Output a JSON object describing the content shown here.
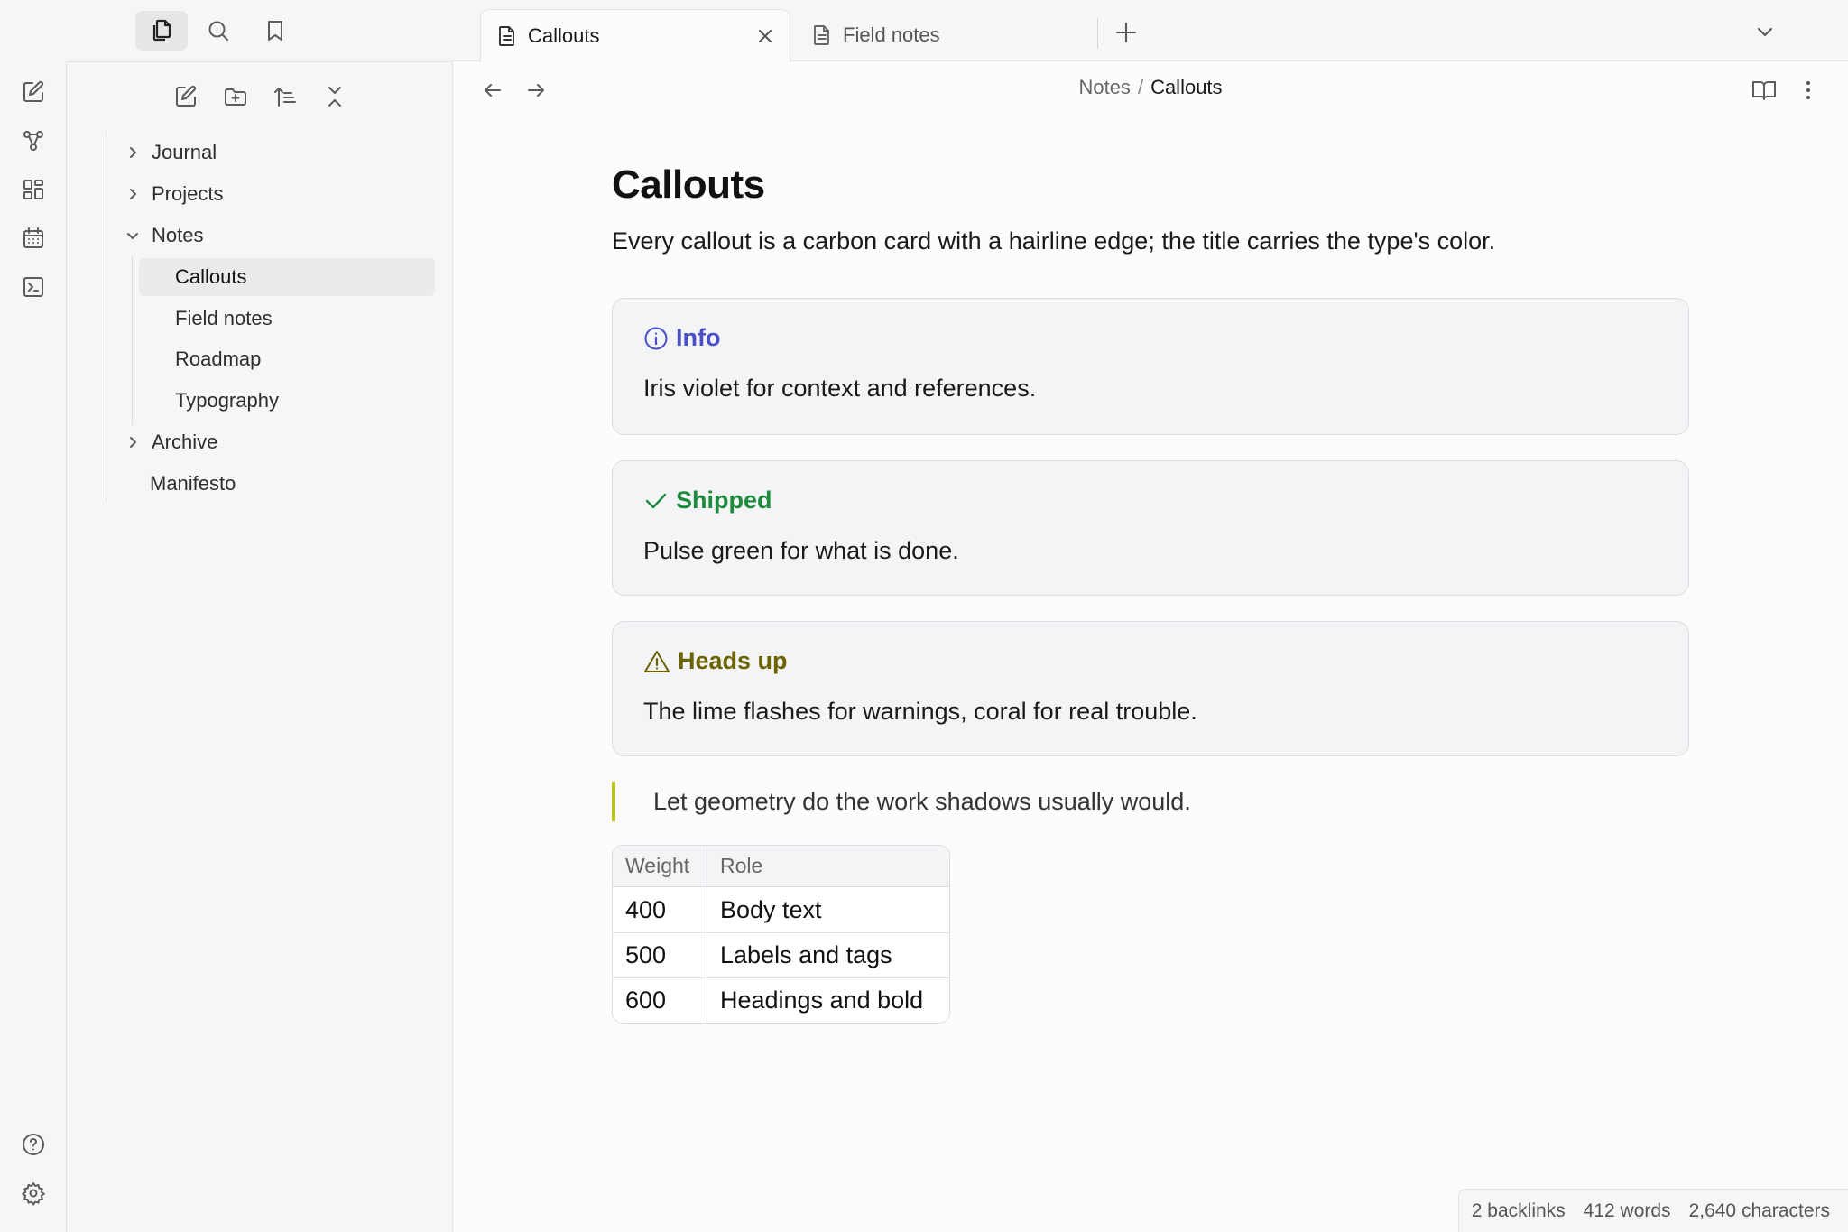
{
  "tabs": [
    {
      "label": "Callouts",
      "active": true
    },
    {
      "label": "Field notes",
      "active": false
    }
  ],
  "breadcrumb": {
    "parent": "Notes",
    "separator": "/",
    "current": "Callouts"
  },
  "sidebar": {
    "tree": [
      {
        "label": "Journal",
        "type": "folder",
        "expanded": false
      },
      {
        "label": "Projects",
        "type": "folder",
        "expanded": false
      },
      {
        "label": "Notes",
        "type": "folder",
        "expanded": true
      },
      {
        "label": "Callouts",
        "type": "file",
        "active": true
      },
      {
        "label": "Field notes",
        "type": "file"
      },
      {
        "label": "Roadmap",
        "type": "file"
      },
      {
        "label": "Typography",
        "type": "file"
      },
      {
        "label": "Archive",
        "type": "folder",
        "expanded": false
      },
      {
        "label": "Manifesto",
        "type": "file"
      }
    ]
  },
  "page": {
    "title": "Callouts",
    "intro": "Every callout is a carbon card with a hairline edge; the title carries the type's color.",
    "callouts": [
      {
        "title": "Info",
        "body": "Iris violet for context and references.",
        "color": "#4b4ec6",
        "icon": "info-icon"
      },
      {
        "title": "Shipped",
        "body": "Pulse green for what is done.",
        "color": "#1e8a3c",
        "icon": "check-icon"
      },
      {
        "title": "Heads up",
        "body": "The lime flashes for warnings, coral for real trouble.",
        "color": "#6b6200",
        "icon": "warning-icon"
      }
    ],
    "quote": "Let geometry do the work shadows usually would.",
    "table": {
      "headers": [
        "Weight",
        "Role"
      ],
      "rows": [
        [
          "400",
          "Body text"
        ],
        [
          "500",
          "Labels and tags"
        ],
        [
          "600",
          "Headings and bold"
        ]
      ]
    }
  },
  "status": {
    "backlinks": "2 backlinks",
    "words": "412 words",
    "characters": "2,640 characters"
  },
  "colors": {
    "quote_bar": "#b8c61a",
    "callout_bg": "#f3f4f6"
  }
}
